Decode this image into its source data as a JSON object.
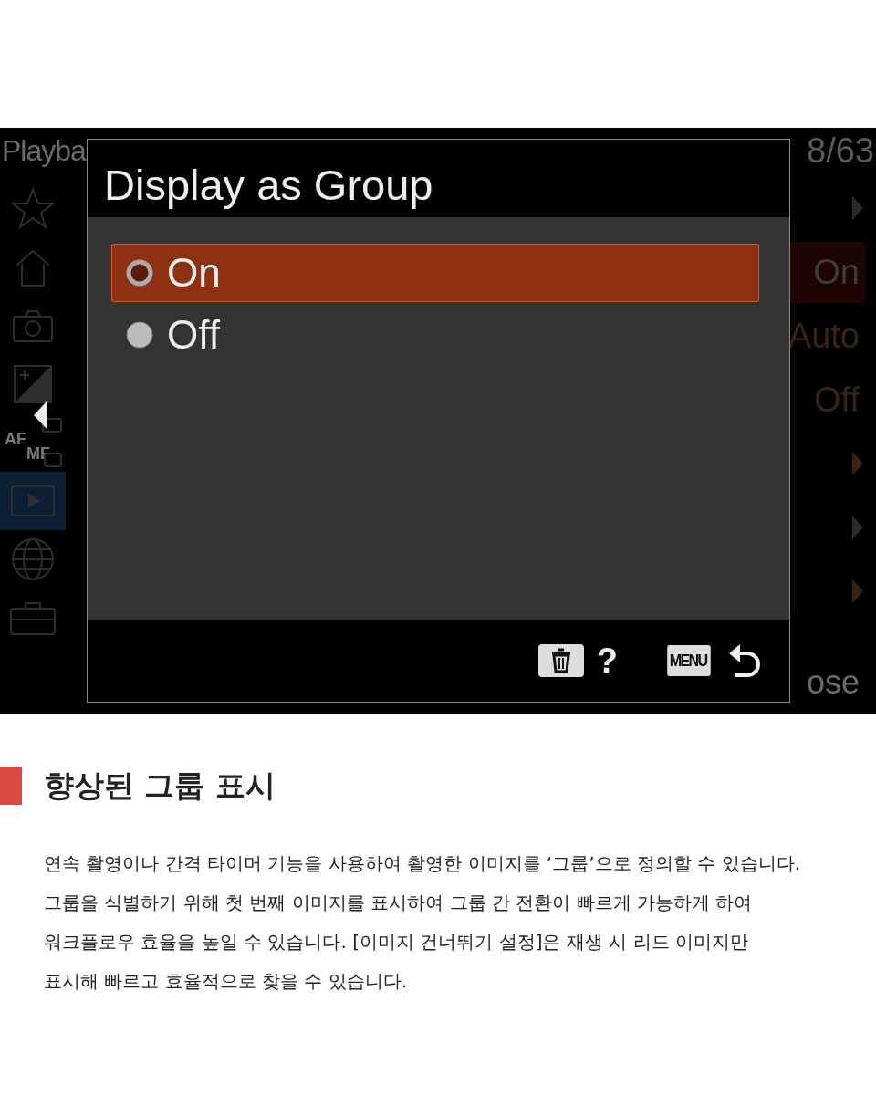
{
  "camera_screen": {
    "background_menu": {
      "title": "Playba",
      "page": "8/63",
      "tabs": [
        {
          "kind": "star",
          "selected": false
        },
        {
          "kind": "house",
          "selected": false
        },
        {
          "kind": "camera",
          "selected": false
        },
        {
          "kind": "exposure",
          "selected": false
        },
        {
          "kind": "afmf",
          "labels": [
            "AF",
            "MF"
          ],
          "selected": false
        },
        {
          "kind": "play",
          "selected": true
        },
        {
          "kind": "globe",
          "selected": false
        },
        {
          "kind": "toolbox",
          "selected": false
        }
      ],
      "values": [
        {
          "kind": "arrow",
          "color": "#2a2a2a"
        },
        {
          "kind": "value",
          "text": "On",
          "color": "#3c3c3c",
          "selected": true
        },
        {
          "kind": "value",
          "text": "Auto",
          "color": "#3a240e",
          "selected": false
        },
        {
          "kind": "value",
          "text": "Off",
          "color": "#3a240e",
          "selected": false
        },
        {
          "kind": "arrow",
          "color": "#3a240e"
        },
        {
          "kind": "arrow",
          "color": "#2a2a2a"
        },
        {
          "kind": "arrow",
          "color": "#3a240e"
        }
      ],
      "footer": "ose"
    },
    "dialog": {
      "title": "Display as Group",
      "options": [
        {
          "label": "On",
          "selected": true
        },
        {
          "label": "Off",
          "selected": false
        }
      ],
      "footer": {
        "help": "?",
        "menu_key": "MENU"
      }
    }
  },
  "section": {
    "heading": "향상된 그룹 표시",
    "paragraph_lines": [
      "연속 촬영이나 간격 타이머 기능을 사용하여 촬영한 이미지를 ‘그룹’으로 정의할 수 있습니다.",
      "그룹을 식별하기 위해 첫 번째 이미지를 표시하여 그룹 간 전환이 빠르게 가능하게 하여",
      "워크플로우 효율을 높일 수 있습니다. [이미지 건너뛰기 설정]은 재생 시 리드 이미지만",
      "표시해 빠르고 효율적으로 찾을 수 있습니다."
    ]
  }
}
